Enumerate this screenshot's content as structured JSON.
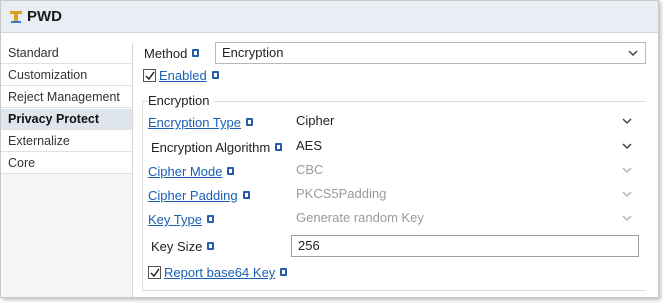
{
  "header": {
    "title": "PWD",
    "icon": "component-icon"
  },
  "sidebar": {
    "items": [
      {
        "label": "Standard"
      },
      {
        "label": "Customization"
      },
      {
        "label": "Reject Management"
      },
      {
        "label": "Privacy Protect",
        "active": true
      },
      {
        "label": "Externalize"
      },
      {
        "label": "Core"
      }
    ]
  },
  "main": {
    "method_label": "Method",
    "method_value": "Encryption",
    "enabled_label": "Enabled",
    "enabled_checked": true,
    "group_title": "Encryption",
    "fields": {
      "encryption_type": {
        "label": "Encryption Type",
        "value": "Cipher"
      },
      "encryption_algorithm": {
        "label": "Encryption Algorithm",
        "value": "AES"
      },
      "cipher_mode": {
        "label": "Cipher Mode",
        "value": "CBC"
      },
      "cipher_padding": {
        "label": "Cipher Padding",
        "value": "PKCS5Padding"
      },
      "key_type": {
        "label": "Key Type",
        "value": "Generate random Key"
      },
      "key_size": {
        "label": "Key Size",
        "value": "256"
      }
    },
    "report_label": "Report base64 Key",
    "report_checked": true
  },
  "colors": {
    "link": "#1a5fb4",
    "info_badge": "#2b5ea8",
    "header_bg": "#e9eef4",
    "active_item_bg": "#dfe5ec"
  }
}
